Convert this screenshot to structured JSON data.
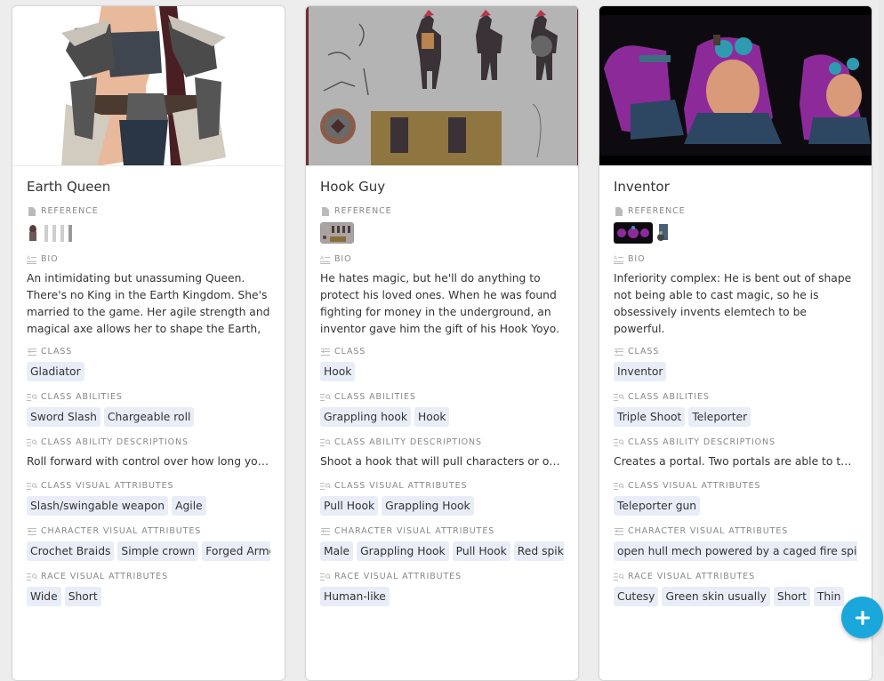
{
  "colors": {
    "chip_bg": "#e8edf8",
    "fab": "#1aa8dc",
    "background": "#ededed"
  },
  "field_labels": {
    "reference": "Reference",
    "bio": "Bio",
    "class": "Class",
    "class_abilities": "Class Abilities",
    "class_ability_descriptions": "Class Ability Descriptions",
    "class_visual_attributes": "Class Visual Attributes",
    "character_visual_attributes": "Character Visual Attributes",
    "race_visual_attributes": "Race Visual Attributes"
  },
  "field_icons": {
    "reference": "attachment-icon",
    "bio": "long-text-icon",
    "class": "link-record-icon",
    "class_abilities": "lookup-icon",
    "class_ability_descriptions": "lookup-icon",
    "class_visual_attributes": "lookup-icon",
    "character_visual_attributes": "link-record-icon",
    "race_visual_attributes": "lookup-icon"
  },
  "cards": [
    {
      "title": "Earth Queen",
      "cover": "earth-queen-cover-image",
      "reference_thumbnails": [
        "earth-queen-portrait-thumbnail",
        "earth-queen-turnaround-thumbnail"
      ],
      "bio": "An intimidating but unassuming Queen. There's no King in the Earth Kingdom. She's married to the game. Her agile strength and magical axe allows her to shape the Earth, for better or for...",
      "class": [
        "Gladiator"
      ],
      "class_abilities": [
        "Sword Slash",
        "Chargeable roll"
      ],
      "class_ability_descriptions": "Roll forward with control over how long you g...",
      "class_visual_attributes": [
        "Slash/swingable weapon",
        "Agile"
      ],
      "character_visual_attributes": [
        "Crochet Braids",
        "Simple crown",
        "Forged Armor"
      ],
      "race_visual_attributes": [
        "Wide",
        "Short"
      ]
    },
    {
      "title": "Hook Guy",
      "cover": "hook-guy-cover-image",
      "reference_thumbnails": [
        "hook-guy-concept-sheet-thumbnail"
      ],
      "bio": "He hates magic, but he'll do anything to protect his loved ones. When he was found fighting for money in the underground, an inventor gave him the gift of his Hook Yoyo. ...",
      "class": [
        "Hook"
      ],
      "class_abilities": [
        "Grappling hook",
        "Hook"
      ],
      "class_ability_descriptions": "Shoot a hook that will pull characters or objec...",
      "class_visual_attributes": [
        "Pull Hook",
        "Grappling Hook"
      ],
      "character_visual_attributes": [
        "Male",
        "Grappling Hook",
        "Pull Hook",
        "Red spiky hair"
      ],
      "race_visual_attributes": [
        "Human-like"
      ]
    },
    {
      "title": "Inventor",
      "cover": "inventor-cover-image",
      "reference_thumbnails": [
        "inventor-bust-render-thumbnail",
        "inventor-mech-thumbnail"
      ],
      "bio": "Inferiority complex: He is bent out of shape not being able to cast magic, so he is obsessively invents elemtech to be powerful.\n...",
      "class": [
        "Inventor"
      ],
      "class_abilities": [
        "Triple Shoot",
        "Teleporter"
      ],
      "class_ability_descriptions": "Creates a portal. Two portals are able to telep...",
      "class_visual_attributes": [
        "Teleporter gun"
      ],
      "character_visual_attributes": [
        "open hull mech powered by a caged fire spirit"
      ],
      "race_visual_attributes": [
        "Cutesy",
        "Green skin usually",
        "Short",
        "Thin"
      ]
    }
  ],
  "fab": {
    "icon": "plus-icon",
    "label": "Add record"
  }
}
